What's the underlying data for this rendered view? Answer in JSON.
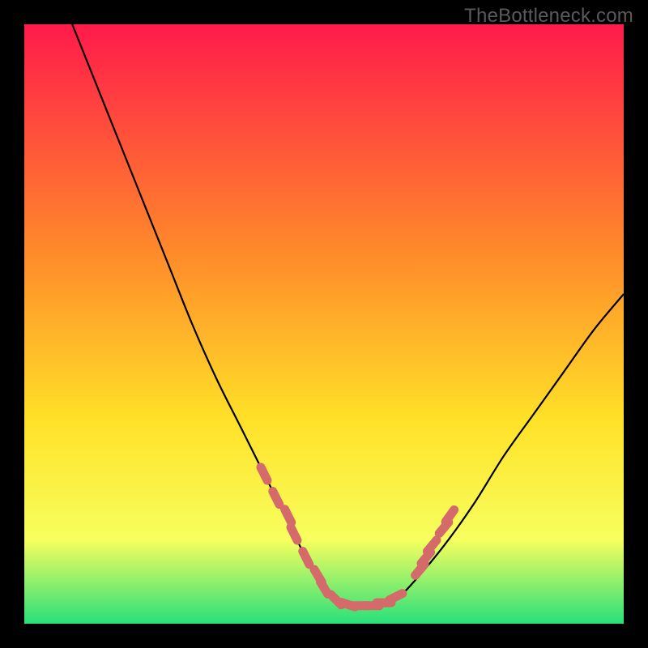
{
  "watermark": "TheBottleneck.com",
  "chart_data": {
    "type": "line",
    "title": "",
    "xlabel": "",
    "ylabel": "",
    "xlim": [
      0,
      100
    ],
    "ylim": [
      0,
      100
    ],
    "gradient_colors": {
      "top": "#ff1a4b",
      "mid1": "#ff8a2a",
      "mid2": "#ffe128",
      "mid3": "#f7ff5e",
      "bottom": "#28e07a"
    },
    "series": [
      {
        "name": "curve",
        "stroke": "#000000",
        "x": [
          8,
          12,
          16,
          20,
          24,
          28,
          32,
          36,
          40,
          44,
          47,
          50,
          52,
          55,
          58,
          60,
          62,
          65,
          70,
          75,
          80,
          85,
          90,
          95,
          100
        ],
        "y": [
          100,
          90,
          80,
          70,
          60,
          50,
          41,
          33,
          25,
          17,
          11,
          6,
          4,
          3,
          3,
          3,
          4,
          7,
          13,
          20,
          28,
          35,
          42,
          49,
          55
        ]
      }
    ],
    "markers": {
      "stroke": "#d46a6a",
      "fill": "#d46a6a",
      "points": [
        {
          "x": 40,
          "y": 25
        },
        {
          "x": 42,
          "y": 21
        },
        {
          "x": 44,
          "y": 18
        },
        {
          "x": 45,
          "y": 15
        },
        {
          "x": 47,
          "y": 11
        },
        {
          "x": 49,
          "y": 8
        },
        {
          "x": 50,
          "y": 6
        },
        {
          "x": 52,
          "y": 4
        },
        {
          "x": 54,
          "y": 3.2
        },
        {
          "x": 56,
          "y": 3
        },
        {
          "x": 58,
          "y": 3
        },
        {
          "x": 60,
          "y": 3.5
        },
        {
          "x": 62,
          "y": 4.5
        },
        {
          "x": 66,
          "y": 9
        },
        {
          "x": 67,
          "y": 11
        },
        {
          "x": 68,
          "y": 13
        },
        {
          "x": 70,
          "y": 16
        },
        {
          "x": 71,
          "y": 18
        }
      ]
    }
  }
}
